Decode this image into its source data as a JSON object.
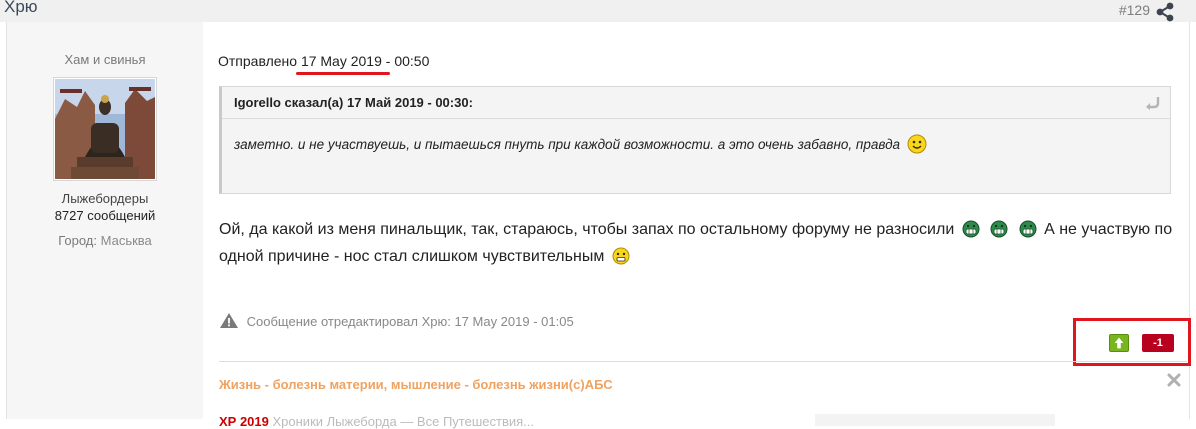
{
  "header": {
    "author": "Хрю",
    "post_number": "#129",
    "share_icon": "share-icon"
  },
  "sidebar": {
    "user_title": "Хам и свинья",
    "avatar_alt": "buddha-statue-avatar",
    "group": "Лыжебордеры",
    "posts_count": "8727 сообщений",
    "city_label": "Город:",
    "city_value": "Маськва"
  },
  "post": {
    "posted_prefix": "Отправлено",
    "posted_date": "17 May 2019 - 00:50",
    "quote": {
      "author_line": "Igorello сказал(а) 17 Май 2019 - 00:30:",
      "text": "заметно. и не участвуешь, и пытаешься пнуть при каждой возможности. а это очень забавно, правда"
    },
    "body_part1": "Ой, да какой из меня пинальщик, так, стараюсь, чтобы запах по остальному форуму не разносили",
    "body_part2": "А не участвую по одной причине - нос стал слишком чувствительным",
    "edit_note": "Сообщение отредактировал Хрю: 17 May 2019 - 01:05",
    "reputation": "-1",
    "signature": "Жизнь - болезнь материи, мышление - болезнь жизни(с)АБС",
    "cut_off_red": "ХР 2019",
    "cut_off_text": "Хроники Лыжеборда — Все Путешествия..."
  },
  "colors": {
    "accent_red": "#e0161e",
    "rep_up_green": "#79b51c",
    "rep_count_red": "#b8001f",
    "signature_orange": "#f0a260"
  }
}
